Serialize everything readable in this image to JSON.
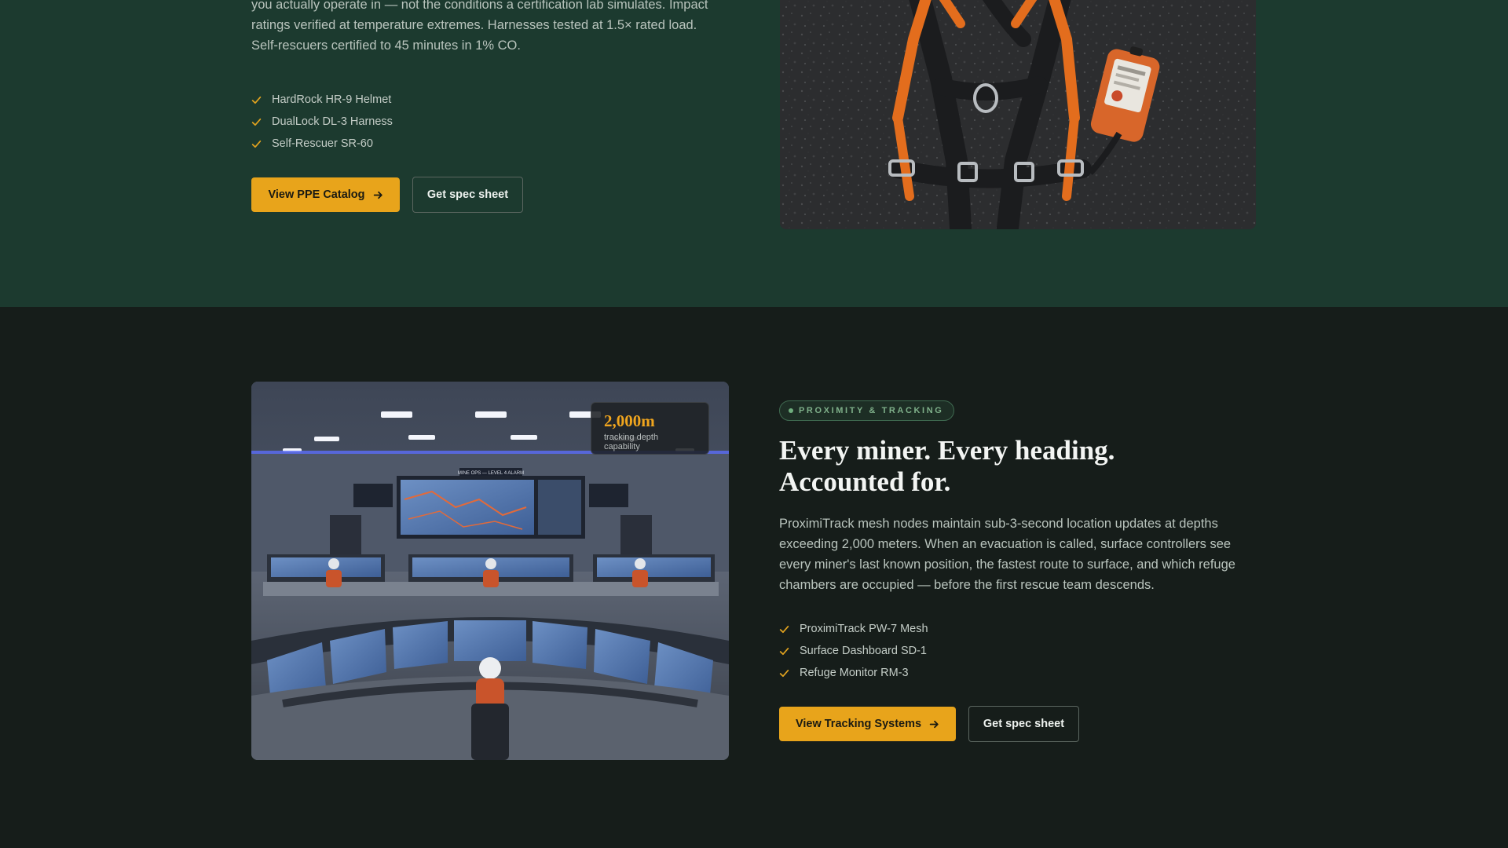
{
  "ppe": {
    "paragraph": "you actually operate in — not the conditions a certification lab simulates. Impact ratings verified at temperature extremes. Harnesses tested at 1.5× rated load. Self-rescuers certified to 45 minutes in 1% CO.",
    "items": [
      "HardRock HR-9 Helmet",
      "DualLock DL-3 Harness",
      "Self-Rescuer SR-60"
    ],
    "primary_button": "View PPE Catalog",
    "secondary_button": "Get spec sheet"
  },
  "tracking": {
    "tag": "PROXIMITY & TRACKING",
    "heading_line1": "Every miner. Every heading.",
    "heading_line2": "Accounted for.",
    "paragraph": "ProximiTrack mesh nodes maintain sub-3-second location updates at depths exceeding 2,000 meters. When an evacuation is called, surface controllers see every miner's last known position, the fastest route to surface, and which refuge chambers are occupied — before the first rescue team descends.",
    "items": [
      "ProximiTrack PW-7 Mesh",
      "Surface Dashboard SD-1",
      "Refuge Monitor RM-3"
    ],
    "primary_button": "View Tracking Systems",
    "secondary_button": "Get spec sheet",
    "stat": {
      "value": "2,000m",
      "label": "tracking depth capability"
    },
    "wall_display_text": "MINE OPS — LEVEL 4 ALARM"
  },
  "colors": {
    "accent": "#e8a41b",
    "ppe_background": "#1c3a2f",
    "tracking_background": "#161d1a",
    "tag_green": "#7fb08a"
  },
  "icons": [
    "check-icon",
    "arrow-right-icon"
  ]
}
